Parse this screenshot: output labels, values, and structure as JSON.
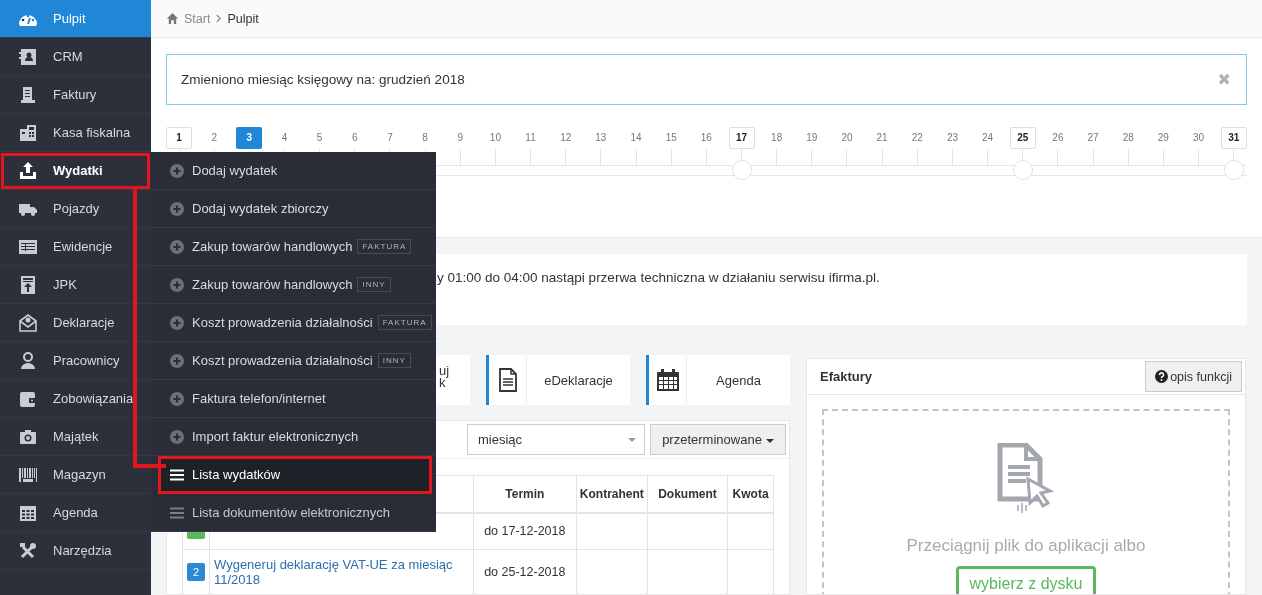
{
  "sidebar": {
    "items": [
      {
        "label": "Pulpit",
        "selected": true,
        "highlighted": false
      },
      {
        "label": "CRM",
        "selected": false,
        "highlighted": false
      },
      {
        "label": "Faktury",
        "selected": false,
        "highlighted": false
      },
      {
        "label": "Kasa fiskalna",
        "selected": false,
        "highlighted": false
      },
      {
        "label": "Wydatki",
        "selected": false,
        "highlighted": true
      },
      {
        "label": "Pojazdy",
        "selected": false,
        "highlighted": false
      },
      {
        "label": "Ewidencje",
        "selected": false,
        "highlighted": false
      },
      {
        "label": "JPK",
        "selected": false,
        "highlighted": false
      },
      {
        "label": "Deklaracje",
        "selected": false,
        "highlighted": false
      },
      {
        "label": "Pracownicy",
        "selected": false,
        "highlighted": false
      },
      {
        "label": "Zobowiązania",
        "selected": false,
        "highlighted": false
      },
      {
        "label": "Majątek",
        "selected": false,
        "highlighted": false
      },
      {
        "label": "Magazyn",
        "selected": false,
        "highlighted": false
      },
      {
        "label": "Agenda",
        "selected": false,
        "highlighted": false
      },
      {
        "label": "Narzędzia",
        "selected": false,
        "highlighted": false
      }
    ]
  },
  "breadcrumb": [
    "Start",
    "Pulpit"
  ],
  "alert": {
    "text": "Zmieniono miesiąc księgowy na: grudzień 2018",
    "close": "✖"
  },
  "timeline": {
    "days": [
      {
        "label": "1",
        "selected": false,
        "marked": true
      },
      {
        "label": "2",
        "selected": false,
        "marked": false
      },
      {
        "label": "3",
        "selected": true,
        "marked": false
      },
      {
        "label": "4",
        "selected": false,
        "marked": false
      },
      {
        "label": "5",
        "selected": false,
        "marked": false
      },
      {
        "label": "6",
        "selected": false,
        "marked": false
      },
      {
        "label": "7",
        "selected": false,
        "marked": false
      },
      {
        "label": "8",
        "selected": false,
        "marked": false
      },
      {
        "label": "9",
        "selected": false,
        "marked": false
      },
      {
        "label": "10",
        "selected": false,
        "marked": false
      },
      {
        "label": "11",
        "selected": false,
        "marked": false
      },
      {
        "label": "12",
        "selected": false,
        "marked": false
      },
      {
        "label": "13",
        "selected": false,
        "marked": false
      },
      {
        "label": "14",
        "selected": false,
        "marked": false
      },
      {
        "label": "15",
        "selected": false,
        "marked": false
      },
      {
        "label": "16",
        "selected": false,
        "marked": false
      },
      {
        "label": "17",
        "selected": false,
        "marked": true,
        "node": true
      },
      {
        "label": "18",
        "selected": false,
        "marked": false
      },
      {
        "label": "19",
        "selected": false,
        "marked": false
      },
      {
        "label": "20",
        "selected": false,
        "marked": false
      },
      {
        "label": "21",
        "selected": false,
        "marked": false
      },
      {
        "label": "22",
        "selected": false,
        "marked": false
      },
      {
        "label": "23",
        "selected": false,
        "marked": false
      },
      {
        "label": "24",
        "selected": false,
        "marked": false
      },
      {
        "label": "25",
        "selected": false,
        "marked": true,
        "node": true
      },
      {
        "label": "26",
        "selected": false,
        "marked": false
      },
      {
        "label": "27",
        "selected": false,
        "marked": false
      },
      {
        "label": "28",
        "selected": false,
        "marked": false
      },
      {
        "label": "29",
        "selected": false,
        "marked": false
      },
      {
        "label": "30",
        "selected": false,
        "marked": false
      },
      {
        "label": "31",
        "selected": false,
        "marked": true,
        "node": true
      }
    ]
  },
  "submenu": {
    "items": [
      {
        "kind": "add",
        "label": "Dodaj wydatek",
        "highlighted": false
      },
      {
        "kind": "add",
        "label": "Dodaj wydatek zbiorczy",
        "highlighted": false
      },
      {
        "kind": "add",
        "label": "Zakup towarów handlowych",
        "tag": "FAKTURA",
        "highlighted": false
      },
      {
        "kind": "add",
        "label": "Zakup towarów handlowych",
        "tag": "INNY",
        "highlighted": false
      },
      {
        "kind": "add",
        "label": "Koszt prowadzenia działalności",
        "tag": "FAKTURA",
        "highlighted": false
      },
      {
        "kind": "add",
        "label": "Koszt prowadzenia działalności",
        "tag": "INNY",
        "highlighted": false
      },
      {
        "kind": "add",
        "label": "Faktura telefon/internet",
        "highlighted": false
      },
      {
        "kind": "add",
        "label": "Import faktur elektronicznych",
        "highlighted": false
      },
      {
        "kind": "list",
        "label": "Lista wydatków",
        "highlighted": true
      },
      {
        "kind": "list",
        "label": "Lista dokumentów elektronicznych",
        "highlighted": false
      }
    ]
  },
  "notice": {
    "text": "y 01:00 do 04:00 nastąpi przerwa techniczna w działaniu serwisu ifirma.pl."
  },
  "tiles": [
    {
      "lines": [
        "uj",
        "k"
      ]
    },
    {
      "lines": [
        "eDeklaracje"
      ]
    },
    {
      "lines": [
        "Agenda"
      ]
    }
  ],
  "tasks": {
    "filter": {
      "value": "miesiąc"
    },
    "status_button": "przeterminowane",
    "columns": [
      "Termin",
      "Kontrahent",
      "Dokument",
      "Kwota"
    ],
    "rows": [
      {
        "badge": {
          "color": "#5cb85c"
        },
        "termin": "do 17-12-2018"
      },
      {
        "badge": {
          "text": "2",
          "color": "#2a8ad4"
        },
        "task": "Wygeneruj deklarację VAT-UE za miesiąc 11/2018",
        "termin": "do 25-12-2018"
      }
    ]
  },
  "efaktury": {
    "title": "Efaktury",
    "help_button": "opis funkcji",
    "drop_text": "Przeciągnij plik do aplikacji albo",
    "pick_button": "wybierz z dysku"
  }
}
